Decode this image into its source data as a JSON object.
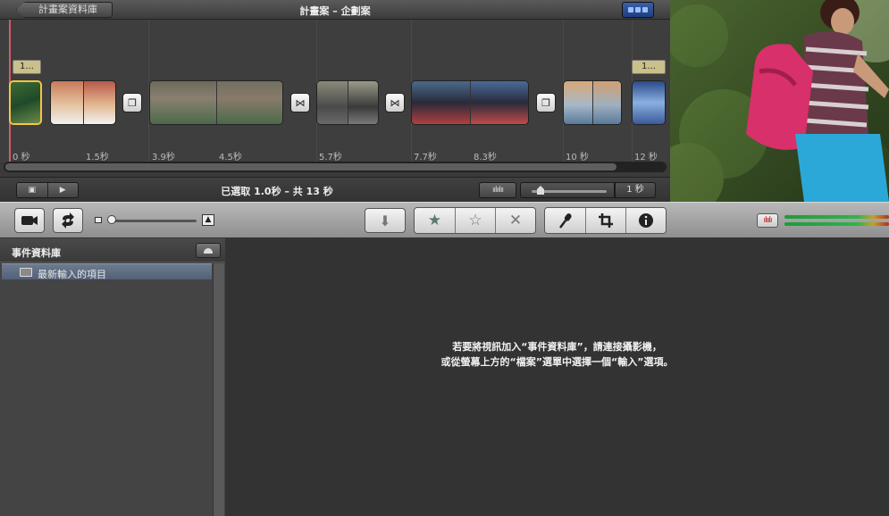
{
  "project": {
    "back_label": "計畫案資料庫",
    "title": "計畫案 – 企劃案",
    "flags": [
      "1...",
      "1..."
    ],
    "ticks": [
      "0 秒",
      "1.5秒",
      "3.9秒",
      "4.5秒",
      "5.7秒",
      "7.7秒",
      "8.3秒",
      "10 秒",
      "12 秒"
    ],
    "selection_status": "已選取 1.0秒 – 共 13 秒",
    "duration_value": "1 秒",
    "duration_slider_level": 0.1
  },
  "toolbar": {
    "buttons": {
      "import": "⬇",
      "favorite": "★",
      "unmark": "☆",
      "reject": "✕",
      "voiceover": "🎤",
      "crop": "⌗",
      "info": "ℹ"
    },
    "zoom_level": 0.0
  },
  "library": {
    "title": "事件資料庫",
    "items": [
      {
        "label": "最新輸入的項目"
      }
    ]
  },
  "browser": {
    "empty_line1": "若要將視訊加入“事件資料庫”，請連接攝影機，",
    "empty_line2": "或從螢幕上方的“檔案”選單中選擇一個“輸入”選項。"
  },
  "colors": {
    "accent": "#f5c542",
    "playhead": "#d35a6a",
    "selection": "#5a6880"
  }
}
